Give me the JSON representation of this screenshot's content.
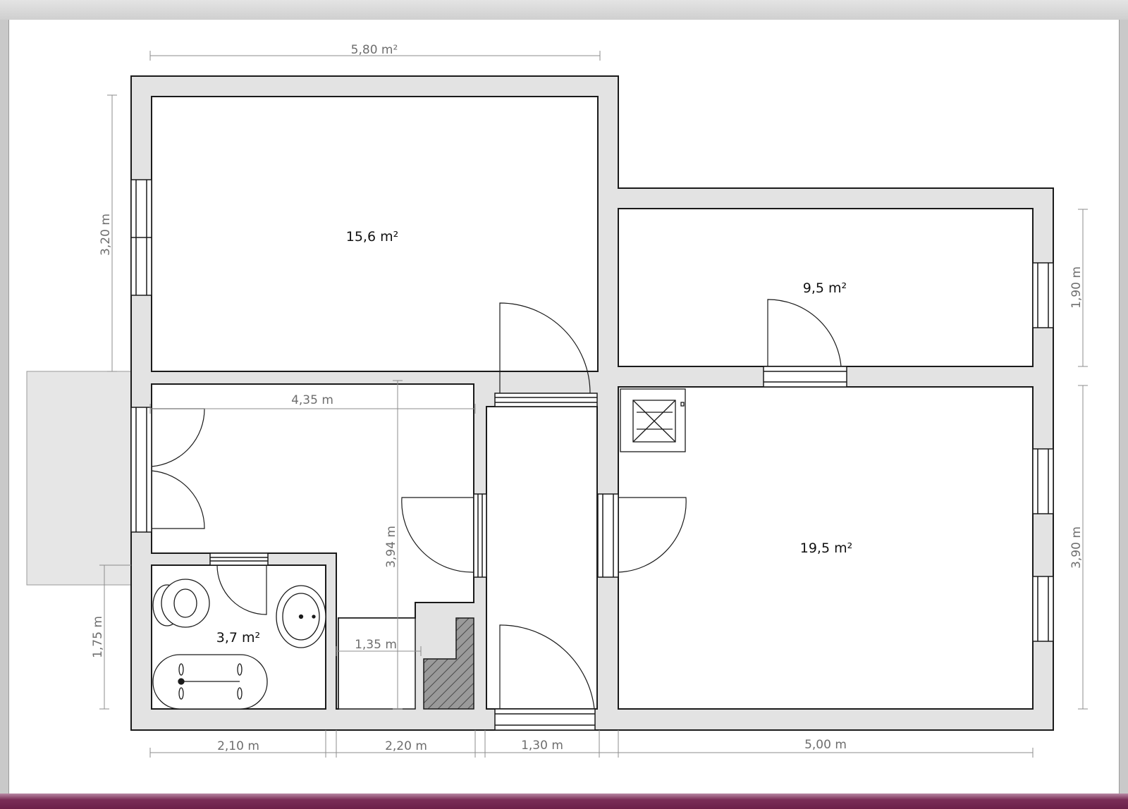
{
  "rooms": {
    "bedroom_area": "15,6 m²",
    "small_room_area": "9,5 m²",
    "living_area": "19,5 m²",
    "bath_area": "3,7 m²"
  },
  "dimensions": {
    "top_width": "5,80 m²",
    "left_upper_height": "3,20 m",
    "left_lower_height": "1,75 m",
    "hall_width": "4,35 m",
    "hall_height": "3,94 m",
    "step_width": "1,35 m",
    "right_upper_height": "1,90 m",
    "right_lower_height": "3,90 m",
    "bottom_1": "2,10 m",
    "bottom_2": "2,20 m",
    "bottom_3": "1,30 m",
    "bottom_4": "5,00 m"
  },
  "colors": {
    "wall_fill": "#e3e3e3",
    "wall_stroke": "#1a1a1a",
    "dimension": "#8c8c8c",
    "window_bar": "#6b2049"
  }
}
